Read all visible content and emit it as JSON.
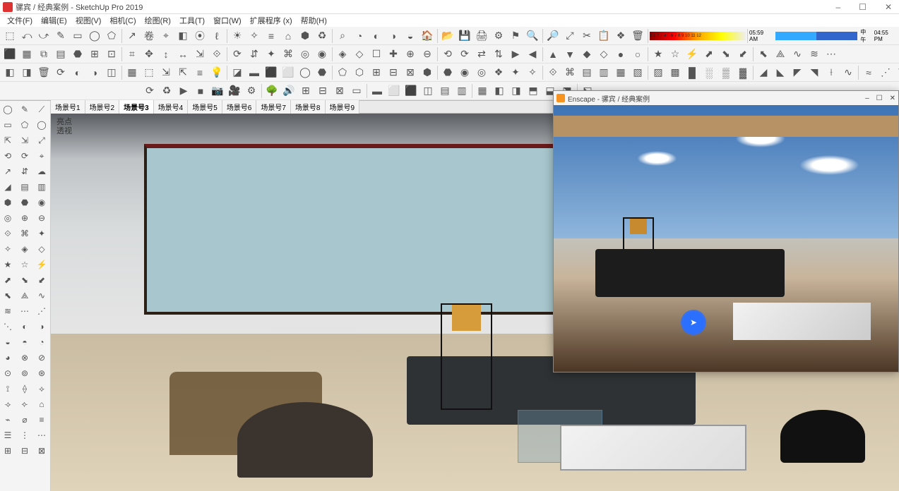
{
  "app": {
    "title": "骡宾 / 经典案例 - SketchUp Pro 2019",
    "window_controls": {
      "min": "–",
      "max": "☐",
      "close": "✕"
    }
  },
  "menu": {
    "file": "文件(F)",
    "edit": "编辑(E)",
    "view": "视图(V)",
    "camera": "相机(C)",
    "draw": "绘图(R)",
    "tools": "工具(T)",
    "window": "窗口(W)",
    "extensions": "扩展程序 (x)",
    "help": "帮助(H)"
  },
  "time_bar": {
    "left_time": "05:59 AM",
    "noon": "中午",
    "right_time": "04:55 PM"
  },
  "gradient_ticks": "0 1 2 3 4 5 6 7 8 9 10 11 12",
  "scene_tabs": [
    "场景号1",
    "场景号2",
    "场景号3",
    "场景号4",
    "场景号5",
    "场景号6",
    "场景号7",
    "场景号8",
    "场景号9"
  ],
  "active_scene_index": 2,
  "viewport_overlay": {
    "line1": "亮点",
    "line2": "透视"
  },
  "enscape": {
    "title": "Enscape - 骡宾 / 经典案例",
    "window_controls": {
      "min": "–",
      "max": "☐",
      "close": "✕"
    }
  },
  "toolbar_rows": {
    "row1": [
      "⬚",
      "⤺",
      "⤻",
      "✎",
      "▭",
      "◯",
      "⬠",
      "↗",
      "卷",
      "⌖",
      "◧",
      "⦿",
      "ℓ",
      "☀",
      "✧",
      "≡",
      "⌂",
      "⬢",
      "♻",
      "⌕",
      "◔",
      "◐",
      "◑",
      "◒",
      "🏠",
      "📂",
      "💾",
      "🖨",
      "⚙",
      "⚑",
      "🔍",
      "🔎",
      "⤢",
      "✂",
      "📋",
      "❖",
      "🗑"
    ],
    "row2": [
      "⬛",
      "▦",
      "⧉",
      "▤",
      "⬣",
      "⊞",
      "⊡",
      "⌗",
      "✥",
      "↕",
      "↔",
      "⇲",
      "⟐",
      "⟳",
      "⇵",
      "✦",
      "⌘",
      "◎",
      "◉",
      "◈",
      "◇",
      "☐",
      "✚",
      "⊕",
      "⊖",
      "⟲",
      "⟳",
      "⇄",
      "⇅",
      "▶",
      "◀",
      "▲",
      "▼",
      "◆",
      "◇",
      "●",
      "○",
      "★",
      "☆",
      "⚡",
      "⬈",
      "⬊",
      "⬋",
      "⬉",
      "⟁",
      "∿",
      "≋",
      "⋯"
    ],
    "row3": [
      "◧",
      "◨",
      "🗑",
      "⟳",
      "◐",
      "◑",
      "◫",
      "▦",
      "⬚",
      "⇲",
      "⇱",
      "≡",
      "💡",
      "◪",
      "▬",
      "⬛",
      "⬜",
      "◯",
      "⬣",
      "⬠",
      "⬡",
      "⊞",
      "⊟",
      "⊠",
      "⬢",
      "⬣",
      "◉",
      "◎",
      "❖",
      "✦",
      "✧",
      "⟐",
      "⌘",
      "▤",
      "▥",
      "▦",
      "▧",
      "▨",
      "▩",
      "█",
      "░",
      "▒",
      "▓",
      "◢",
      "◣",
      "◤",
      "◥",
      "⟊",
      "∿",
      "≈",
      "⋰",
      "⋱"
    ],
    "row4": [
      "⟳",
      "♻",
      "▶",
      "■",
      "📷",
      "🎥",
      "⚙",
      "🌳",
      "🔊",
      "⊞",
      "⊟",
      "⊠",
      "▭",
      "▬",
      "⬜",
      "⬛",
      "◫",
      "▤",
      "▥",
      "▦",
      "◧",
      "◨",
      "⬒",
      "⬓",
      "⬔",
      "⬕"
    ]
  },
  "left_tools": [
    "◯",
    "✎",
    "⟋",
    "▭",
    "⬠",
    "◯",
    "⇱",
    "⇲",
    "⤢",
    "⟲",
    "⟳",
    "⌖",
    "↗",
    "⇵",
    "☁",
    "◢",
    "▤",
    "▥",
    "⬢",
    "⬣",
    "◉",
    "◎",
    "⊕",
    "⊖",
    "⟐",
    "⌘",
    "✦",
    "✧",
    "◈",
    "◇",
    "★",
    "☆",
    "⚡",
    "⬈",
    "⬊",
    "⬋",
    "⬉",
    "⟁",
    "∿",
    "≋",
    "⋯",
    "⋰",
    "⋱",
    "◐",
    "◑",
    "◒",
    "◓",
    "◔",
    "◕",
    "⊗",
    "⊘",
    "⊙",
    "⊚",
    "⊛",
    "⟟",
    "⟠",
    "⟡",
    "⟢",
    "⟣",
    "⌂",
    "⌁",
    "⌀",
    "≡",
    "☰",
    "⋮",
    "⋯",
    "⊞",
    "⊟",
    "⊠"
  ]
}
